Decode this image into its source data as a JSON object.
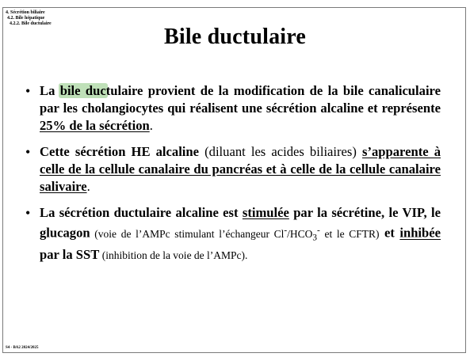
{
  "breadcrumb": {
    "l1": "4. Sécrétion biliaire",
    "l2": "4.2. Bile hépatique",
    "l3": "4.2.2. Bile ductulaire"
  },
  "title": "Bile ductulaire",
  "bullets": {
    "b1": {
      "t1": "La ",
      "hl": "bile duc",
      "t2": "tulaire provient de la modification de la bile canaliculaire par les cholangiocytes qui réalisent une sécrétion alcaline et représente ",
      "u": "25% de la sécrétion",
      "t3": "."
    },
    "b2": {
      "t1": "Cette sécrétion HE alcaline",
      "t2": " (diluant les acides biliaires) ",
      "u": "s’apparente à celle de la cellule canalaire du pancréas et à celle de la cellule canalaire salivaire",
      "t3": "."
    },
    "b3": {
      "t1": "La sécrétion ductulaire alcaline est ",
      "u1": "stimulée",
      "t2": " par la sécrétine, le VIP, le glucagon",
      "s1": " (voie de l’AMPc stimulant l’échangeur Cl",
      "sup1": "-",
      "s2": "/HCO",
      "sub": "3",
      "sup2": "-",
      "s3": " et le CFTR)",
      "t3": " et ",
      "u2": "inhibée",
      "t4": " par la SST",
      "s4": " (inhibition de la voie de l’AMPc)."
    },
    "dot": "•"
  },
  "footer": "S4 - BA2 2024/2025",
  "colors": {
    "highlight": "#bfe0b8",
    "frame": "#7a7a7a"
  }
}
